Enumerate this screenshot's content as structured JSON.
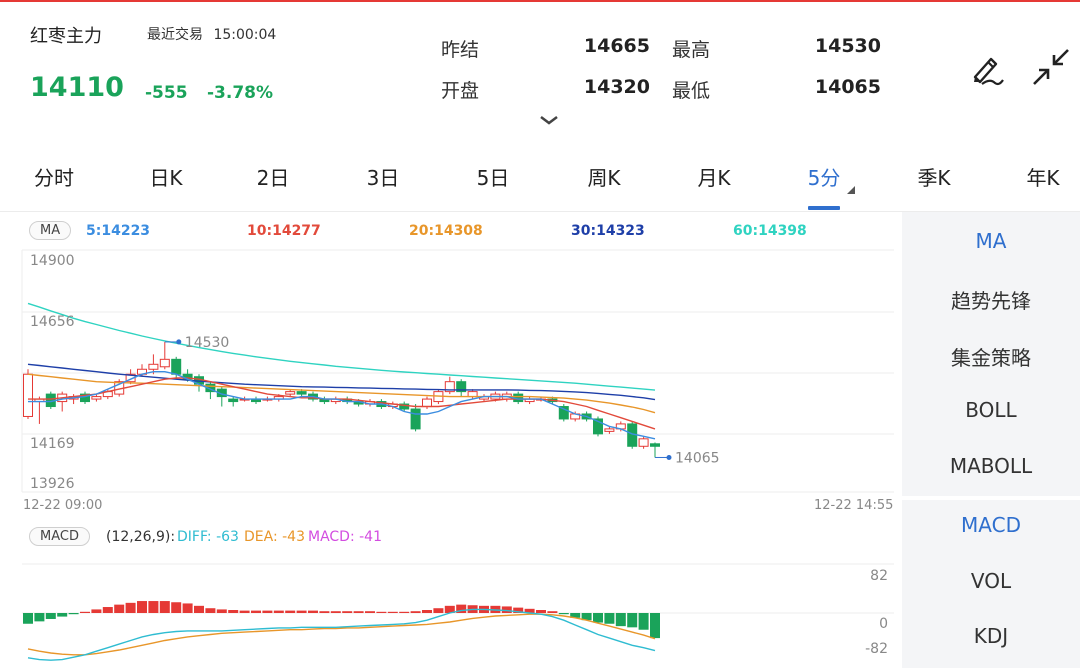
{
  "quote": {
    "name": "红枣主力",
    "status": "最近交易",
    "time": "15:00:04",
    "price": "14110",
    "change": "-555",
    "change_pct": "-3.78%",
    "prev_settle_label": "昨结",
    "prev_settle": "14665",
    "high_label": "最高",
    "high": "14530",
    "open_label": "开盘",
    "open": "14320",
    "low_label": "最低",
    "low": "14065"
  },
  "colors": {
    "up": "#e53935",
    "down": "#1aa35a",
    "accent": "#2f6fce"
  },
  "tabs": [
    {
      "label": "分时"
    },
    {
      "label": "日K"
    },
    {
      "label": "2日"
    },
    {
      "label": "3日"
    },
    {
      "label": "5日"
    },
    {
      "label": "周K"
    },
    {
      "label": "月K"
    },
    {
      "label": "5分",
      "active": true
    },
    {
      "label": "季K"
    },
    {
      "label": "年K"
    }
  ],
  "ma_legend": {
    "badge": "MA",
    "ma5": "5:14223",
    "ma10": "10:14277",
    "ma20": "20:14308",
    "ma30": "30:14323",
    "ma60": "60:14398"
  },
  "macd_legend": {
    "badge": "MACD",
    "params": "(12,26,9):",
    "diff": "DIFF: -63",
    "dea": "DEA: -43",
    "macd": "MACD: -41"
  },
  "main_sidebar": [
    {
      "label": "MA",
      "active": true
    },
    {
      "label": "趋势先锋"
    },
    {
      "label": "集金策略"
    },
    {
      "label": "BOLL"
    },
    {
      "label": "MABOLL"
    }
  ],
  "sub_sidebar": [
    {
      "label": "MACD",
      "active": true
    },
    {
      "label": "VOL"
    },
    {
      "label": "KDJ"
    }
  ],
  "chart_data": [
    {
      "type": "candlestick",
      "y_ticks": [
        "14900",
        "14656",
        "14169",
        "13926"
      ],
      "ylim": [
        13926,
        14900
      ],
      "x_start": "12-22 09:00",
      "x_end": "12-22 14:55",
      "high_annotation": "14530",
      "low_annotation": "14065",
      "candles": [
        [
          14230,
          14400,
          14220,
          14420
        ],
        [
          14290,
          14300,
          14200,
          14310
        ],
        [
          14320,
          14270,
          14260,
          14330
        ],
        [
          14290,
          14320,
          14250,
          14330
        ],
        [
          14300,
          14310,
          14280,
          14320
        ],
        [
          14320,
          14290,
          14280,
          14330
        ],
        [
          14300,
          14310,
          14290,
          14320
        ],
        [
          14310,
          14330,
          14300,
          14340
        ],
        [
          14320,
          14370,
          14310,
          14380
        ],
        [
          14370,
          14400,
          14360,
          14420
        ],
        [
          14400,
          14420,
          14390,
          14440
        ],
        [
          14420,
          14440,
          14400,
          14480
        ],
        [
          14430,
          14460,
          14420,
          14530
        ],
        [
          14460,
          14400,
          14380,
          14470
        ],
        [
          14400,
          14380,
          14370,
          14420
        ],
        [
          14390,
          14360,
          14330,
          14400
        ],
        [
          14360,
          14330,
          14300,
          14370
        ],
        [
          14340,
          14310,
          14270,
          14350
        ],
        [
          14300,
          14290,
          14270,
          14310
        ],
        [
          14300,
          14300,
          14290,
          14310
        ],
        [
          14300,
          14290,
          14280,
          14310
        ],
        [
          14300,
          14300,
          14290,
          14310
        ],
        [
          14300,
          14310,
          14290,
          14320
        ],
        [
          14320,
          14330,
          14310,
          14340
        ],
        [
          14330,
          14320,
          14310,
          14340
        ],
        [
          14320,
          14300,
          14290,
          14330
        ],
        [
          14300,
          14290,
          14280,
          14310
        ],
        [
          14290,
          14300,
          14280,
          14310
        ],
        [
          14300,
          14290,
          14280,
          14310
        ],
        [
          14290,
          14280,
          14270,
          14300
        ],
        [
          14280,
          14290,
          14270,
          14300
        ],
        [
          14290,
          14270,
          14260,
          14300
        ],
        [
          14270,
          14280,
          14260,
          14290
        ],
        [
          14280,
          14260,
          14250,
          14290
        ],
        [
          14260,
          14180,
          14170,
          14280
        ],
        [
          14270,
          14300,
          14260,
          14310
        ],
        [
          14290,
          14330,
          14280,
          14340
        ],
        [
          14330,
          14370,
          14320,
          14390
        ],
        [
          14370,
          14330,
          14310,
          14380
        ],
        [
          14310,
          14330,
          14300,
          14340
        ],
        [
          14300,
          14310,
          14290,
          14320
        ],
        [
          14300,
          14320,
          14290,
          14330
        ],
        [
          14300,
          14320,
          14290,
          14330
        ],
        [
          14320,
          14290,
          14280,
          14330
        ],
        [
          14290,
          14300,
          14280,
          14310
        ],
        [
          14300,
          14300,
          14290,
          14310
        ],
        [
          14300,
          14290,
          14280,
          14310
        ],
        [
          14270,
          14220,
          14210,
          14280
        ],
        [
          14220,
          14240,
          14210,
          14250
        ],
        [
          14240,
          14220,
          14210,
          14250
        ],
        [
          14220,
          14160,
          14150,
          14230
        ],
        [
          14170,
          14180,
          14160,
          14190
        ],
        [
          14180,
          14200,
          14170,
          14210
        ],
        [
          14200,
          14110,
          14100,
          14210
        ],
        [
          14110,
          14140,
          14100,
          14150
        ],
        [
          14120,
          14110,
          14065,
          14125
        ]
      ],
      "ma5": [
        14290,
        14290,
        14290,
        14300,
        14305,
        14310,
        14320,
        14340,
        14360,
        14380,
        14400,
        14410,
        14410,
        14400,
        14380,
        14360,
        14340,
        14320,
        14310,
        14300,
        14300,
        14300,
        14300,
        14300,
        14310,
        14310,
        14300,
        14300,
        14290,
        14290,
        14280,
        14280,
        14270,
        14250,
        14240,
        14240,
        14250,
        14270,
        14290,
        14300,
        14310,
        14310,
        14310,
        14300,
        14300,
        14300,
        14280,
        14260,
        14240,
        14230,
        14210,
        14190,
        14180,
        14160,
        14150,
        14140
      ],
      "ma10": [
        14300,
        14300,
        14300,
        14305,
        14310,
        14315,
        14320,
        14330,
        14340,
        14350,
        14360,
        14370,
        14380,
        14385,
        14385,
        14380,
        14370,
        14360,
        14350,
        14340,
        14330,
        14320,
        14315,
        14310,
        14305,
        14305,
        14300,
        14300,
        14300,
        14295,
        14290,
        14285,
        14280,
        14275,
        14270,
        14270,
        14270,
        14275,
        14280,
        14285,
        14290,
        14295,
        14300,
        14300,
        14300,
        14300,
        14295,
        14290,
        14280,
        14270,
        14255,
        14240,
        14225,
        14210,
        14195,
        14180
      ],
      "ma20": [
        14400,
        14395,
        14390,
        14385,
        14380,
        14375,
        14370,
        14368,
        14366,
        14365,
        14364,
        14362,
        14360,
        14358,
        14356,
        14354,
        14352,
        14350,
        14348,
        14346,
        14344,
        14342,
        14340,
        14338,
        14336,
        14334,
        14332,
        14330,
        14328,
        14326,
        14324,
        14322,
        14320,
        14318,
        14316,
        14314,
        14312,
        14310,
        14310,
        14310,
        14310,
        14310,
        14310,
        14310,
        14310,
        14308,
        14306,
        14304,
        14300,
        14296,
        14290,
        14284,
        14276,
        14268,
        14258,
        14245
      ],
      "ma30": [
        14440,
        14435,
        14430,
        14425,
        14420,
        14415,
        14410,
        14405,
        14400,
        14396,
        14392,
        14388,
        14384,
        14380,
        14376,
        14372,
        14369,
        14366,
        14363,
        14360,
        14358,
        14356,
        14354,
        14352,
        14350,
        14349,
        14348,
        14347,
        14346,
        14345,
        14344,
        14343,
        14342,
        14341,
        14340,
        14339,
        14338,
        14337,
        14337,
        14337,
        14337,
        14337,
        14337,
        14336,
        14335,
        14334,
        14333,
        14331,
        14329,
        14326,
        14323,
        14319,
        14315,
        14310,
        14305,
        14298
      ],
      "ma60": [
        14685,
        14670,
        14655,
        14640,
        14625,
        14612,
        14600,
        14588,
        14576,
        14565,
        14554,
        14544,
        14534,
        14525,
        14516,
        14507,
        14499,
        14491,
        14484,
        14477,
        14470,
        14464,
        14458,
        14452,
        14447,
        14442,
        14437,
        14432,
        14428,
        14424,
        14420,
        14416,
        14412,
        14409,
        14406,
        14403,
        14400,
        14397,
        14394,
        14391,
        14388,
        14385,
        14382,
        14379,
        14376,
        14373,
        14370,
        14367,
        14364,
        14360,
        14356,
        14352,
        14348,
        14344,
        14340,
        14336
      ]
    },
    {
      "type": "bar",
      "y_ticks": [
        "82",
        "0",
        "-82"
      ],
      "ylim": [
        -82,
        82
      ],
      "macd": [
        -18,
        -14,
        -10,
        -6,
        -2,
        2,
        6,
        10,
        14,
        17,
        20,
        20,
        20,
        18,
        16,
        12,
        8,
        6,
        5,
        4,
        4,
        4,
        4,
        4,
        4,
        4,
        3,
        3,
        3,
        3,
        3,
        2,
        2,
        2,
        3,
        5,
        8,
        12,
        14,
        13,
        12,
        12,
        11,
        9,
        7,
        5,
        3,
        -2,
        -8,
        -12,
        -16,
        -18,
        -22,
        -24,
        -28,
        -42
      ],
      "diff": [
        -75,
        -78,
        -79,
        -78,
        -74,
        -70,
        -64,
        -58,
        -52,
        -46,
        -40,
        -36,
        -33,
        -31,
        -30,
        -30,
        -30,
        -30,
        -29,
        -28,
        -27,
        -26,
        -25,
        -25,
        -24,
        -24,
        -24,
        -24,
        -23,
        -22,
        -21,
        -20,
        -19,
        -18,
        -16,
        -12,
        -6,
        0,
        4,
        6,
        6,
        5,
        4,
        2,
        0,
        -2,
        -6,
        -12,
        -20,
        -28,
        -36,
        -42,
        -48,
        -54,
        -58,
        -63
      ],
      "dea": [
        -60,
        -64,
        -67,
        -69,
        -70,
        -70,
        -68,
        -65,
        -62,
        -58,
        -54,
        -50,
        -46,
        -43,
        -40,
        -38,
        -36,
        -34,
        -33,
        -32,
        -31,
        -30,
        -29,
        -28,
        -28,
        -27,
        -26,
        -26,
        -25,
        -25,
        -24,
        -23,
        -22,
        -21,
        -20,
        -19,
        -17,
        -15,
        -12,
        -9,
        -7,
        -5,
        -4,
        -3,
        -2,
        -2,
        -3,
        -5,
        -8,
        -12,
        -17,
        -22,
        -27,
        -32,
        -37,
        -43
      ]
    }
  ]
}
